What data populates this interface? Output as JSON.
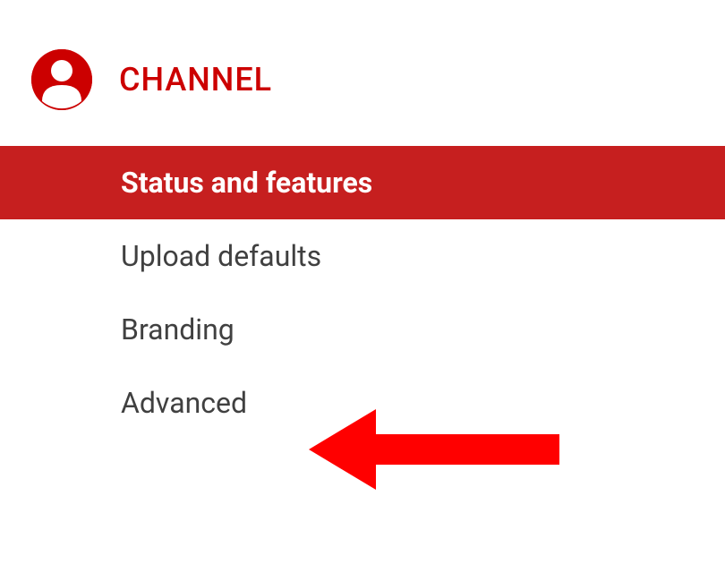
{
  "header": {
    "title": "CHANNEL"
  },
  "menu": {
    "items": [
      {
        "label": "Status and features",
        "active": true
      },
      {
        "label": "Upload defaults",
        "active": false
      },
      {
        "label": "Branding",
        "active": false
      },
      {
        "label": "Advanced",
        "active": false
      }
    ]
  },
  "colors": {
    "accent": "#CC0000",
    "activeBg": "#C61F1F",
    "arrow": "#FF0000"
  }
}
